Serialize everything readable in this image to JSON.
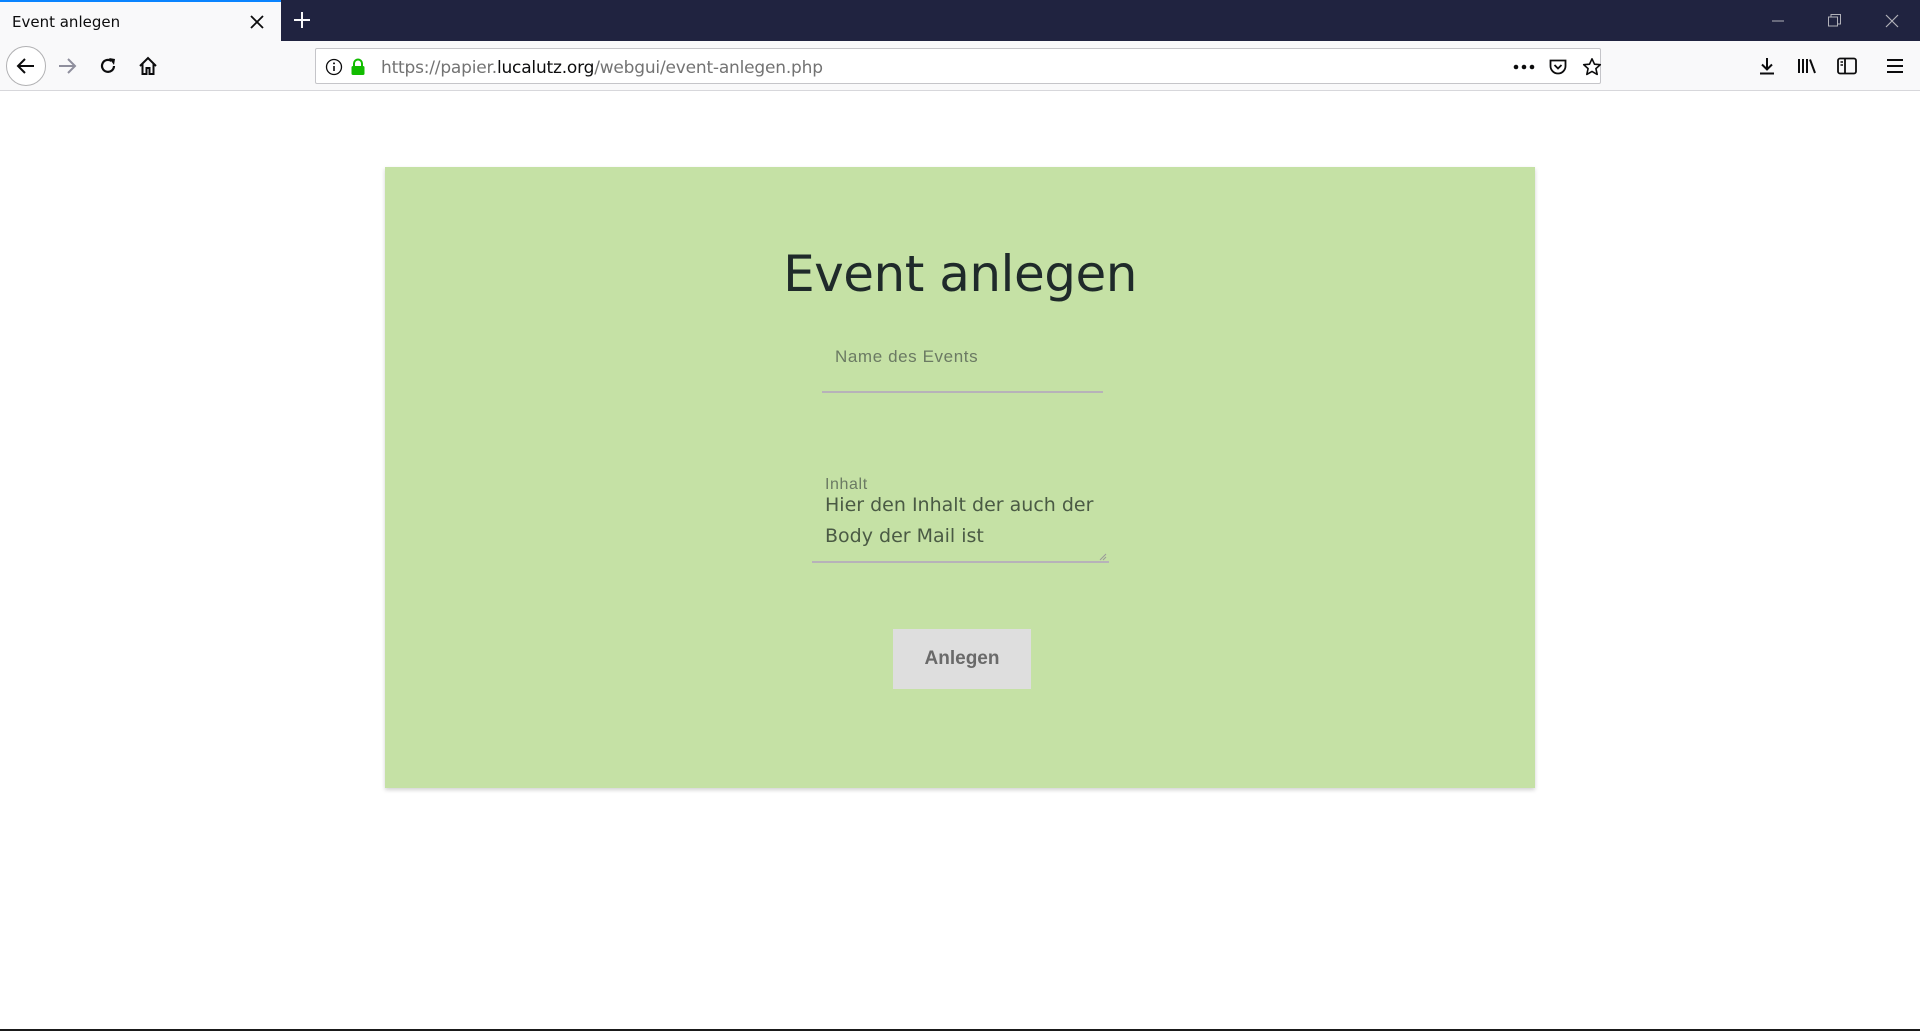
{
  "browser": {
    "tab_title": "Event anlegen",
    "url": {
      "prefix": "https://papier.",
      "host": "lucalutz.org",
      "path": "/webgui/event-anlegen.php"
    },
    "accent": "#0a84ff",
    "tabstrip_color": "#202340",
    "lock_color": "#12bc00",
    "icons": [
      "close-icon",
      "plus-icon",
      "minimize-icon",
      "restore-icon",
      "window-close-icon",
      "back-icon",
      "forward-icon",
      "reload-icon",
      "home-icon",
      "info-icon",
      "lock-icon",
      "more-icon",
      "pocket-icon",
      "star-icon",
      "download-icon",
      "library-icon",
      "sidebar-icon",
      "menu-icon"
    ]
  },
  "page": {
    "card_color": "#c5e1a5",
    "heading": "Event anlegen",
    "name_field": {
      "label": "Name des Events",
      "value": ""
    },
    "content_field": {
      "label": "Inhalt",
      "placeholder": "Hier den Inhalt der auch der Body der Mail ist"
    },
    "submit_label": "Anlegen"
  }
}
